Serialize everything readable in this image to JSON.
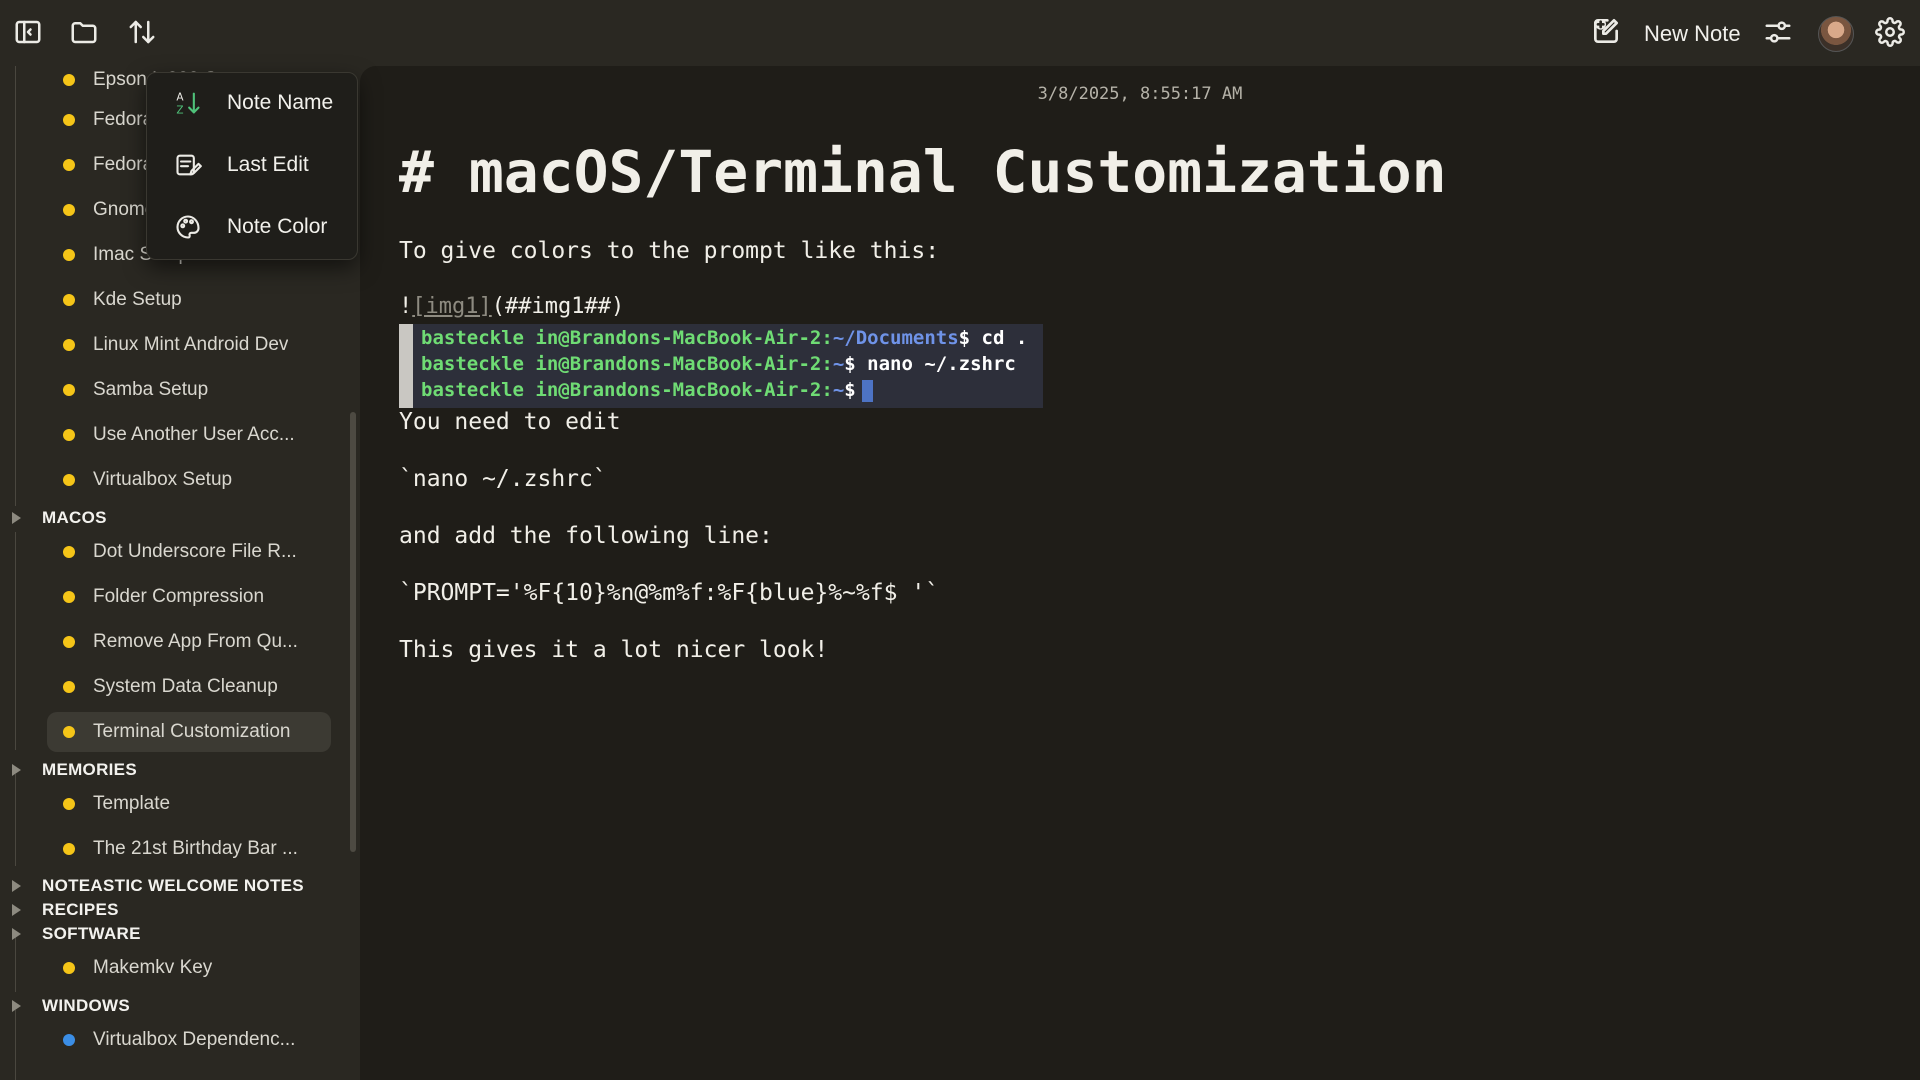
{
  "toolbar": {
    "new_note_label": "New Note",
    "icons": [
      "sidebar-toggle-icon",
      "folder-icon",
      "sort-icon",
      "new-note-icon",
      "filter-sliders-icon",
      "avatar",
      "gear-icon"
    ]
  },
  "sort_menu": {
    "items": [
      {
        "label": "Note Name",
        "icon": "sort-az-icon"
      },
      {
        "label": "Last Edit",
        "icon": "last-edit-icon"
      },
      {
        "label": "Note Color",
        "icon": "palette-icon"
      }
    ]
  },
  "sidebar": {
    "notes_top": [
      {
        "label": "Epson L 300 Setup",
        "color": "#f5c518"
      },
      {
        "label": "Fedora Setup",
        "color": "#f5c518"
      },
      {
        "label": "Fedora Setup",
        "color": "#f5c518"
      },
      {
        "label": "Gnome Setup",
        "color": "#f5c518"
      },
      {
        "label": "Imac Setup",
        "color": "#f5c518"
      },
      {
        "label": "Kde Setup",
        "color": "#f5c518"
      },
      {
        "label": "Linux Mint Android Dev",
        "color": "#f5c518"
      },
      {
        "label": "Samba Setup",
        "color": "#f5c518"
      },
      {
        "label": "Use Another User Acc...",
        "color": "#f5c518"
      },
      {
        "label": "Virtualbox Setup",
        "color": "#f5c518"
      }
    ],
    "folders": {
      "macos": "MACOS",
      "memories": "MEMORIES",
      "noteastic": "NOTEASTIC WELCOME NOTES",
      "recipes": "RECIPES",
      "software": "SOFTWARE",
      "windows": "WINDOWS"
    },
    "macos_notes": [
      {
        "label": "Dot Underscore File R...",
        "color": "#f5c518"
      },
      {
        "label": "Folder Compression",
        "color": "#f5c518"
      },
      {
        "label": "Remove App From Qu...",
        "color": "#f5c518"
      },
      {
        "label": "System Data Cleanup",
        "color": "#f5c518"
      },
      {
        "label": "Terminal Customization",
        "color": "#f5c518",
        "selected": true
      }
    ],
    "memories_notes": [
      {
        "label": "Template",
        "color": "#f5c518"
      },
      {
        "label": "The 21st Birthday Bar ...",
        "color": "#f5c518"
      }
    ],
    "software_notes": [
      {
        "label": "Makemkv Key",
        "color": "#f5c518"
      }
    ],
    "windows_notes": [
      {
        "label": "Virtualbox Dependenc...",
        "color": "#3b8ee6"
      }
    ]
  },
  "editor": {
    "timestamp": "3/8/2025, 8:55:17 AM",
    "heading": "# macOS/Terminal Customization",
    "p1": "To give colors to the prompt like this:",
    "img_prefix": "!",
    "img_link": "[img1]",
    "img_suffix": "(##img1##)",
    "terminal": {
      "line1_user": "basteckle in@Brandons-MacBook-Air-2:",
      "line1_path": "~/Documents",
      "line1_cmd": "$ cd .",
      "line2_user": "basteckle in@Brandons-MacBook-Air-2:",
      "line2_path": "~",
      "line2_cmd": "$ nano ~/.zshrc",
      "line3_user": "basteckle in@Brandons-MacBook-Air-2:",
      "line3_path": "~",
      "line3_cmd": "$"
    },
    "p2": "You need to edit",
    "p3": "`nano ~/.zshrc`",
    "p4": "and add the following line:",
    "p5": "`PROMPT='%F{10}%n@%m%f:%F{blue}%~%f$ '`",
    "p6": "This gives it a lot nicer look!"
  }
}
